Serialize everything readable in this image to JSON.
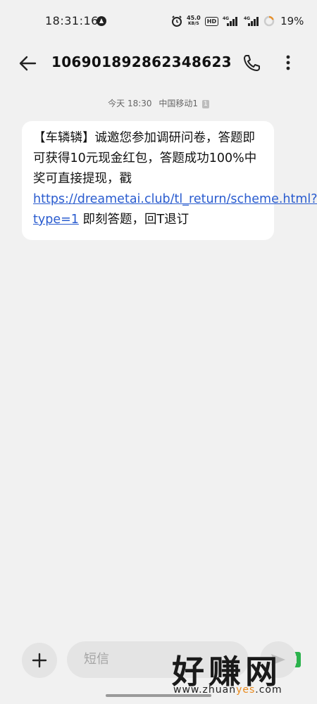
{
  "status_bar": {
    "time": "18:31:16",
    "speed_value": "45.0",
    "speed_unit": "KB/S",
    "hd_label": "HD",
    "network_1": "4G",
    "network_2": "4G",
    "battery_percent": "19%"
  },
  "header": {
    "title": "106901892862348623"
  },
  "message": {
    "timestamp": "今天 18:30",
    "carrier": "中国移动1",
    "sim_badge": "1",
    "text_before_link": "【车辚辚】诚邀您参加调研问卷，答题即可获得10元现金红包，答题成功100%中奖可直接提现，戳",
    "link_text": "https://dreametai.club/tl_return/scheme.html?type=1",
    "text_after_link": " 即刻答题，回T退订"
  },
  "composer": {
    "placeholder": "短信",
    "plus_icon": "plus-icon",
    "send_icon": "send-icon"
  },
  "watermark": {
    "text": "好赚网",
    "url_prefix": "www.zhuan",
    "url_highlight": "yes",
    "url_suffix": ".com"
  },
  "colors": {
    "background": "#f1f1f1",
    "bubble": "#ffffff",
    "link": "#2a5ccf",
    "watermark_accent": "#e98a1d"
  }
}
